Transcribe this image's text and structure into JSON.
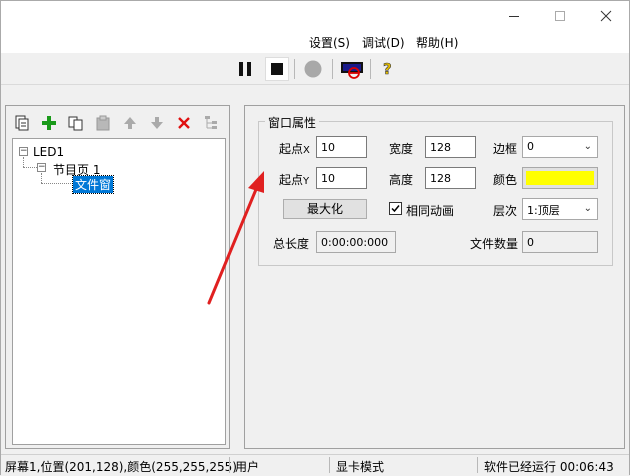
{
  "menu": [
    "设置(S)",
    "调试(D)",
    "帮助(H)"
  ],
  "toolbar": {
    "icons": [
      "pause-icon",
      "stop-icon",
      "record-icon",
      "display-icon",
      "help-icon"
    ],
    "help_glyph": "?"
  },
  "tree": {
    "root": "LED1",
    "program": "节目页 1",
    "file_window": "文件窗"
  },
  "props": {
    "group_title": "窗口属性",
    "x_label_main": "起点",
    "x_label_axis": "X",
    "x_value": "10",
    "y_label_main": "起点",
    "y_label_axis": "Y",
    "y_value": "10",
    "width_label": "宽度",
    "width_value": "128",
    "height_label": "高度",
    "height_value": "128",
    "border_label": "边框",
    "border_value": "0",
    "color_label": "颜色",
    "color_value": "#ffff00",
    "maximize_label": "最大化",
    "same_anim_label": "相同动画",
    "same_anim_checked": true,
    "layer_label": "层次",
    "layer_value": "1:顶层",
    "total_length_label": "总长度",
    "total_length_value": "0:00:00:000",
    "file_count_label": "文件数量",
    "file_count_value": "0"
  },
  "status": {
    "screen_info": "屏幕1,位置(201,128),颜色(255,255,255)",
    "user": "用户",
    "mode": "显卡模式",
    "runtime": "软件已经运行 00:06:43"
  }
}
